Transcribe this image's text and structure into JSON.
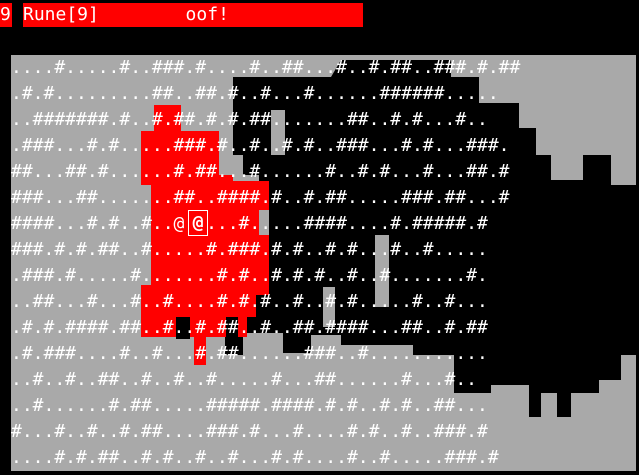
{
  "status": {
    "level": "9",
    "text": "Rune[9]        oof!"
  },
  "map": {
    "rows": [
      "....#.....#..###.#....#..##...#..#.##..###.#.##",
      ".#.#.........##..##.#..#...#......######.....",
      "..#######.#..#.##.#.#.##.......##..#.#...#..",
      ".###...#.#.....###.#..#..#.#..###...#.#...###.",
      "##...##.#......#.##...#......#..#.#...#...##.#",
      "###...##.......##..####.#..#.##.....###.##...#",
      "####...#.#..#..@.....#.....####....#.#####.#",
      "###.#.#.##..#.....#.###.#.#..#.#...#..#.....",
      ".###.#.....#.......#.#..#.#.#..#..#.......#.",
      "..##...#...#..#....#.#.#..#..#.#.....#..#...",
      ".#.#.####.##..#..#.##..#..##.####...##..#.##",
      ".#.###....#..#...#.##......###..#...........",
      "..#..#..##..#..#..#.....#...##......#...#..",
      "..#......#.##.....#####.####.#.#..#.#..##...",
      "#...#..#..#.##....###.#...#....#.#..#..###.#",
      "....#.#.##..#.#..#..#...#.#....#..#.....###.#"
    ],
    "colors": {
      "floor": "#a9a9a9",
      "unlit": "#000000",
      "lit": "#ff0000",
      "glyph": "#ffffff"
    },
    "player_glyph": "@"
  }
}
